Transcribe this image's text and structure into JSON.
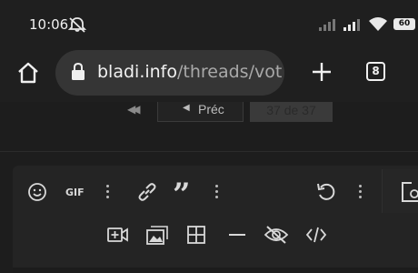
{
  "status_bar": {
    "time": "10:06",
    "battery": "60",
    "icons": [
      "dnd-off-icon",
      "signal-icon",
      "signal-icon",
      "wifi-icon",
      "battery-icon"
    ]
  },
  "browser": {
    "url_domain": "bladi.info",
    "url_path": "/threads/vot",
    "tab_count": "8",
    "icons": [
      "home-icon",
      "lock-icon",
      "new-tab-icon",
      "tab-switcher-icon"
    ]
  },
  "pager": {
    "prev_label": "Préc",
    "current_label": "37 de 37"
  },
  "editor_toolbar": {
    "gif_label": "GIF",
    "row1_icons": [
      "emoji-icon",
      "gif-icon",
      "more-icon",
      "link-icon",
      "quote-icon",
      "more-icon",
      "undo-icon",
      "more-icon",
      "preview-icon"
    ],
    "row2_icons": [
      "video-icon",
      "gallery-icon",
      "table-icon",
      "horizontal-rule-icon",
      "spoiler-icon",
      "code-icon"
    ]
  },
  "colors": {
    "background": "#1a1a1a",
    "toolbar": "#1f1f1f",
    "url_pill": "#353535",
    "editor": "#242424",
    "icon": "#d8d8d8"
  }
}
